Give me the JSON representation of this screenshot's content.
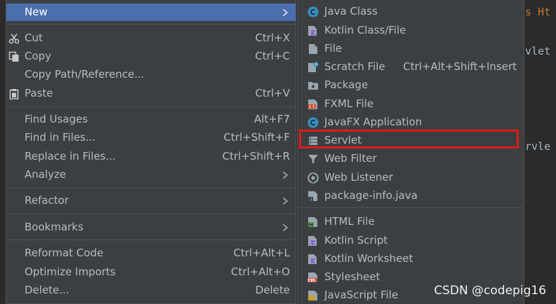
{
  "editor": {
    "frag_top": "s Ht",
    "frag_mid": "vlet",
    "frag_low": "rvle"
  },
  "menu": {
    "new": "New",
    "cut": "Cut",
    "cut_sc": "Ctrl+X",
    "copy": "Copy",
    "copy_sc": "Ctrl+C",
    "copy_path": "Copy Path/Reference...",
    "paste": "Paste",
    "paste_sc": "Ctrl+V",
    "find_usages": "Find Usages",
    "find_usages_sc": "Alt+F7",
    "find_in_files": "Find in Files...",
    "find_in_files_sc": "Ctrl+Shift+F",
    "replace_in_files": "Replace in Files...",
    "replace_in_files_sc": "Ctrl+Shift+R",
    "analyze": "Analyze",
    "refactor": "Refactor",
    "bookmarks": "Bookmarks",
    "reformat": "Reformat Code",
    "reformat_sc": "Ctrl+Alt+L",
    "optimize": "Optimize Imports",
    "optimize_sc": "Ctrl+Alt+O",
    "delete": "Delete...",
    "delete_sc": "Delete"
  },
  "submenu": {
    "java_class": "Java Class",
    "kotlin_class": "Kotlin Class/File",
    "file": "File",
    "scratch": "Scratch File",
    "scratch_sc": "Ctrl+Alt+Shift+Insert",
    "package": "Package",
    "fxml": "FXML File",
    "javafx": "JavaFX Application",
    "servlet": "Servlet",
    "web_filter": "Web Filter",
    "web_listener": "Web Listener",
    "package_info": "package-info.java",
    "html_file": "HTML File",
    "kotlin_script": "Kotlin Script",
    "kotlin_worksheet": "Kotlin Worksheet",
    "stylesheet": "Stylesheet",
    "js_file": "JavaScript File"
  },
  "colors": {
    "menu_bg": "#3c3f41",
    "selection": "#4b6eaf",
    "highlight_box": "#e11a1a",
    "text": "#bbbbbb"
  },
  "watermark": "CSDN @codepig16"
}
